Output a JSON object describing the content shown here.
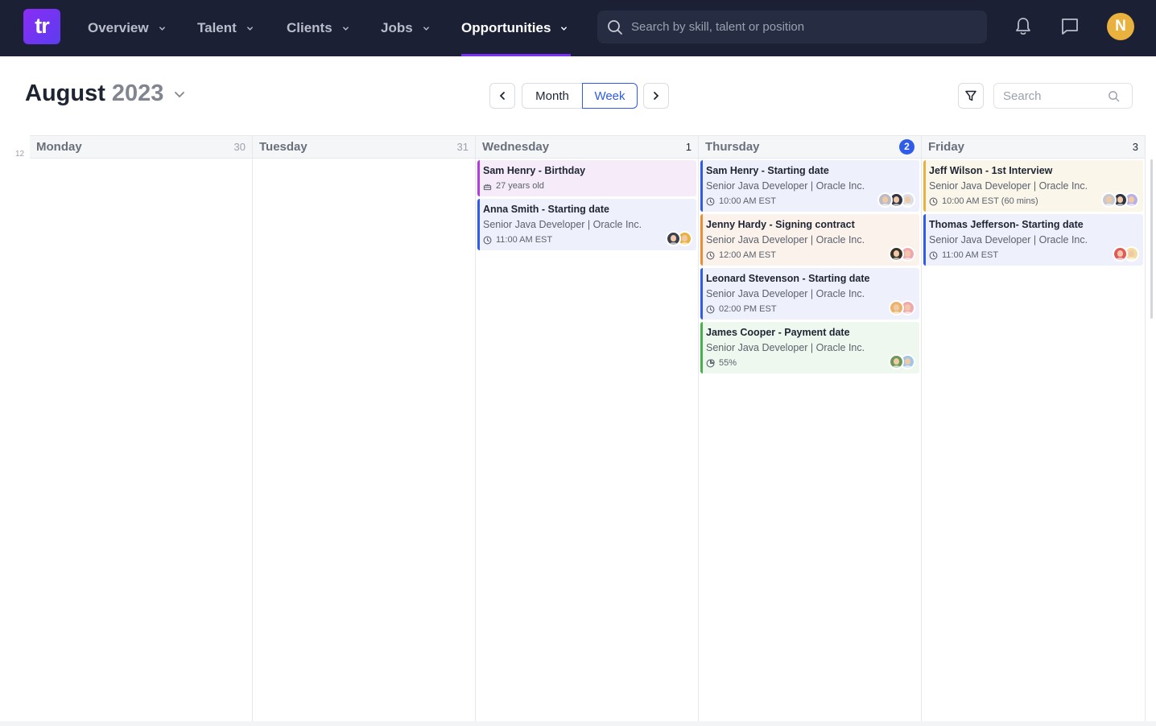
{
  "app": {
    "logo_text": "tr",
    "brand_color": "#7b2ff7",
    "nav": [
      {
        "label": "Overview",
        "active": false
      },
      {
        "label": "Talent",
        "active": false
      },
      {
        "label": "Clients",
        "active": false
      },
      {
        "label": "Jobs",
        "active": false
      },
      {
        "label": "Opportunities",
        "active": true
      }
    ],
    "search_placeholder": "Search by skill, talent or position",
    "user_initial": "N"
  },
  "header": {
    "month": "August",
    "year": "2023",
    "view_month": "Month",
    "view_week": "Week",
    "active_view": "Week",
    "search_placeholder": "Search"
  },
  "calendar": {
    "hour_label": "12",
    "days": [
      {
        "day": "Monday",
        "date": "30",
        "today": false,
        "events": []
      },
      {
        "day": "Tuesday",
        "date": "31",
        "today": false,
        "events": []
      },
      {
        "day": "Wednesday",
        "date": "1",
        "today": false,
        "events": [
          {
            "title": "Sam Henry - Birthday",
            "subtitle": "",
            "meta": "27 years old",
            "meta_icon": "cake-icon",
            "color": "purple",
            "avatars": []
          },
          {
            "title": "Anna Smith - Starting date",
            "subtitle": "Senior Java Developer | Oracle Inc.",
            "meta": "11:00 AM EST",
            "meta_icon": "clock-icon",
            "color": "blue",
            "avatars": [
              "#3a3f52",
              "#e9b13d"
            ]
          }
        ]
      },
      {
        "day": "Thursday",
        "date": "2",
        "today": true,
        "events": [
          {
            "title": "Sam Henry - Starting date",
            "subtitle": "Senior Java Developer | Oracle Inc.",
            "meta": "10:00 AM EST",
            "meta_icon": "clock-icon",
            "color": "blue",
            "avatars": [
              "#b9bcc4",
              "#2f3445",
              "#d9dde4"
            ]
          },
          {
            "title": "Jenny Hardy - Signing contract",
            "subtitle": "Senior Java Developer | Oracle Inc.",
            "meta": "12:00 AM EST",
            "meta_icon": "clock-icon",
            "color": "orange",
            "avatars": [
              "#3b3226",
              "#f0a7ad"
            ]
          },
          {
            "title": "Leonard Stevenson - Starting date",
            "subtitle": "Senior Java Developer | Oracle Inc.",
            "meta": "02:00 PM EST",
            "meta_icon": "clock-icon",
            "color": "blue",
            "avatars": [
              "#e9b46a",
              "#f0a7ad"
            ]
          },
          {
            "title": "James Cooper - Payment date",
            "subtitle": "Senior Java Developer | Oracle Inc.",
            "meta": "55%",
            "meta_icon": "pie-chart-icon",
            "color": "green",
            "avatars": [
              "#6a9a55",
              "#9fc6e8"
            ]
          }
        ]
      },
      {
        "day": "Friday",
        "date": "3",
        "today": false,
        "events": [
          {
            "title": "Jeff Wilson - 1st Interview",
            "subtitle": "Senior Java Developer | Oracle Inc.",
            "meta": "10:00 AM EST (60 mins)",
            "meta_icon": "clock-icon",
            "color": "yellow",
            "avatars": [
              "#c7c9ce",
              "#2f3445",
              "#b9b1e6"
            ]
          },
          {
            "title": "Thomas Jefferson- Starting date",
            "subtitle": "Senior Java Developer | Oracle Inc.",
            "meta": "11:00 AM EST",
            "meta_icon": "clock-icon",
            "color": "blue",
            "avatars": [
              "#e05a5a",
              "#f3dca0"
            ]
          }
        ]
      }
    ]
  }
}
